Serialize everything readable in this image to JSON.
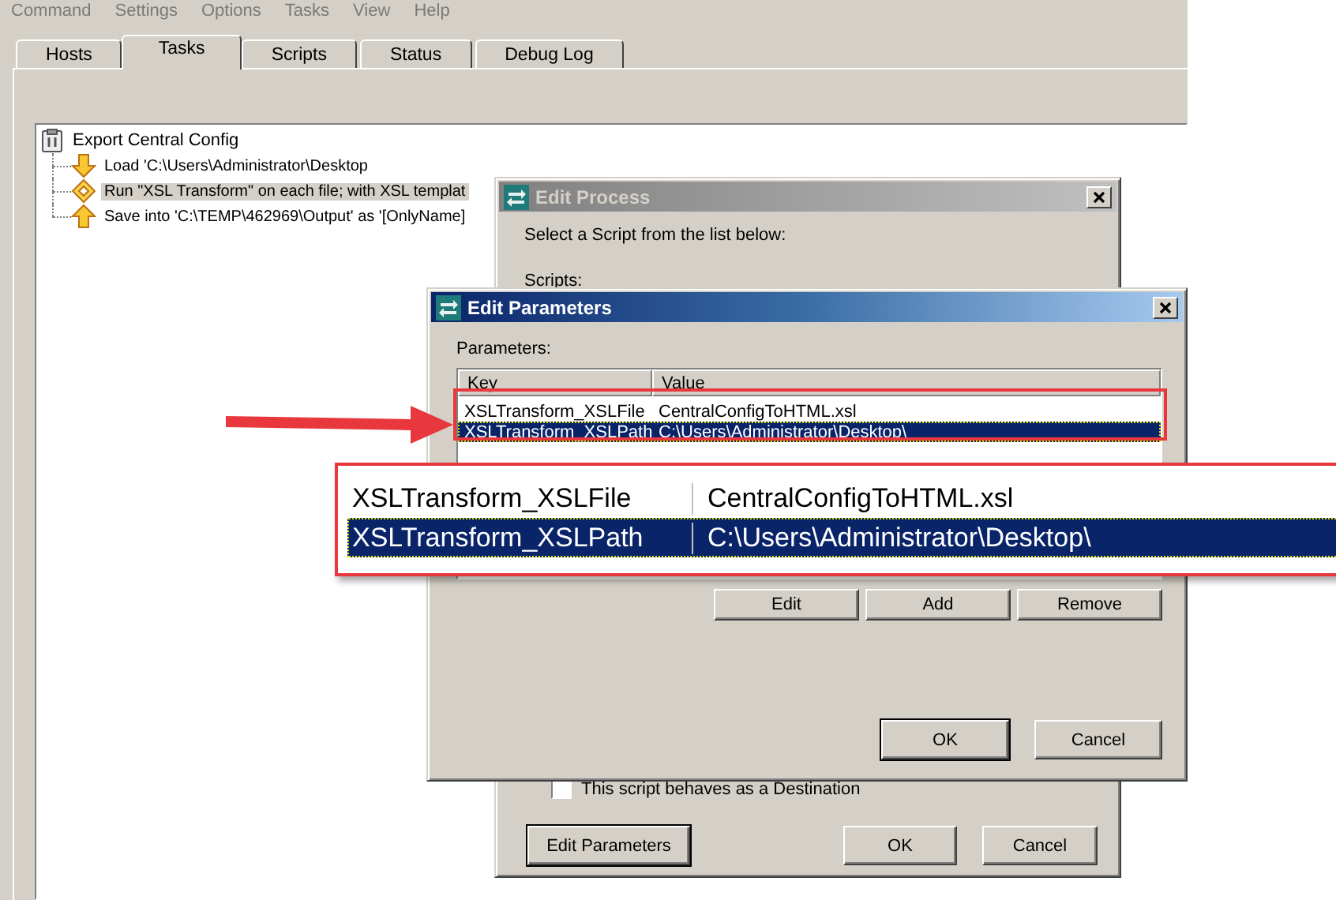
{
  "menu": [
    "Command",
    "Settings",
    "Options",
    "Tasks",
    "View",
    "Help"
  ],
  "tabs": [
    {
      "label": "Hosts",
      "selected": false
    },
    {
      "label": "Tasks",
      "selected": true
    },
    {
      "label": "Scripts",
      "selected": false
    },
    {
      "label": "Status",
      "selected": false
    },
    {
      "label": "Debug Log",
      "selected": false
    }
  ],
  "tree": {
    "label": "Export Central Config",
    "children": [
      {
        "kind": "load",
        "label": "Load 'C:\\Users\\Administrator\\Desktop",
        "selected": false
      },
      {
        "kind": "process",
        "label": "Run \"XSL Transform\" on each file; with XSL templat",
        "selected": true
      },
      {
        "kind": "save",
        "label": "Save into 'C:\\TEMP\\462969\\Output' as '[OnlyName]",
        "selected": false
      }
    ]
  },
  "edit_process": {
    "title": "Edit Process",
    "active": false,
    "prompt": "Select a Script from the list below:",
    "scripts_label": "Scripts:",
    "checkbox": {
      "label": "This script behaves as a Destination",
      "checked": false
    },
    "buttons": [
      {
        "label": "Edit Parameters",
        "default": true
      },
      {
        "label": "OK",
        "default": false
      },
      {
        "label": "Cancel",
        "default": false
      }
    ]
  },
  "edit_parameters": {
    "title": "Edit Parameters",
    "active": true,
    "parameters_label": "Parameters:",
    "columns": [
      "Key",
      "Value"
    ],
    "rows": [
      {
        "key": "XSLTransform_XSLFile",
        "value": "CentralConfigToHTML.xsl",
        "selected": false
      },
      {
        "key": "XSLTransform_XSLPath",
        "value": "C:\\Users\\Administrator\\Desktop\\",
        "selected": true
      }
    ],
    "list_buttons": [
      "Edit",
      "Add",
      "Remove"
    ],
    "buttons": [
      {
        "label": "OK",
        "default": true
      },
      {
        "label": "Cancel",
        "default": false
      }
    ]
  },
  "zoom_inset": {
    "rows": [
      {
        "key": "XSLTransform_XSLFile",
        "value": "CentralConfigToHTML.xsl",
        "selected": false
      },
      {
        "key": "XSLTransform_XSLPath",
        "value": "C:\\Users\\Administrator\\Desktop\\",
        "selected": true
      }
    ]
  }
}
